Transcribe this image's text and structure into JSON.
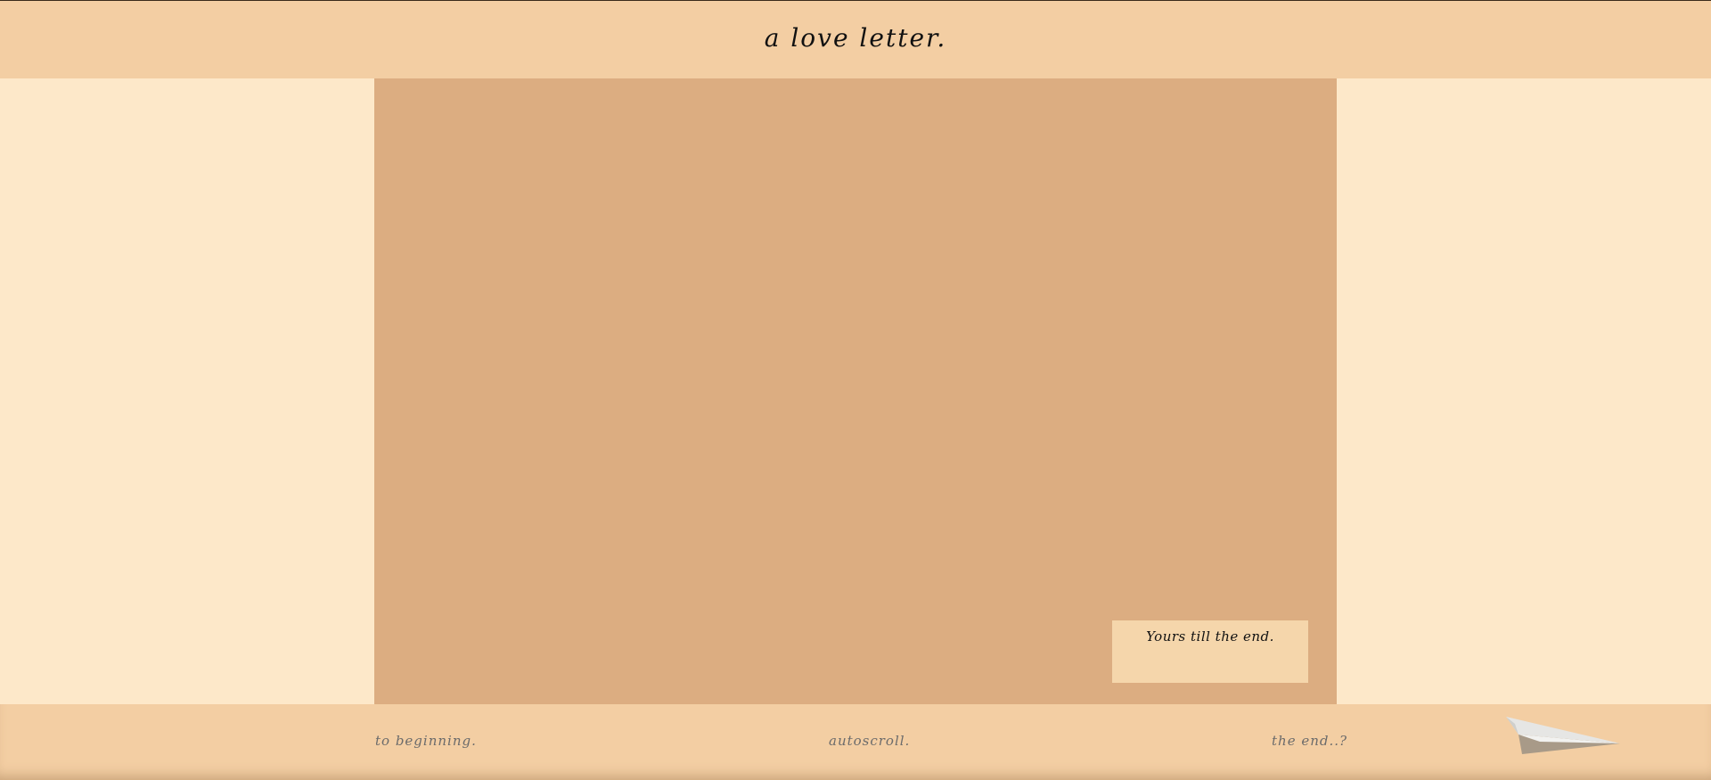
{
  "header": {
    "title": "a love letter."
  },
  "letter": {
    "signoff": "Yours till the end."
  },
  "footer": {
    "to_beginning": "to beginning.",
    "autoscroll": "autoscroll.",
    "the_end": "the end..?"
  },
  "icons": {
    "plane": "paper-plane-icon"
  },
  "colors": {
    "header_bg": "#f3cea3",
    "side_bg": "#fde8c9",
    "letter_bg": "#dcad81",
    "note_bg": "#f5d6ab"
  }
}
